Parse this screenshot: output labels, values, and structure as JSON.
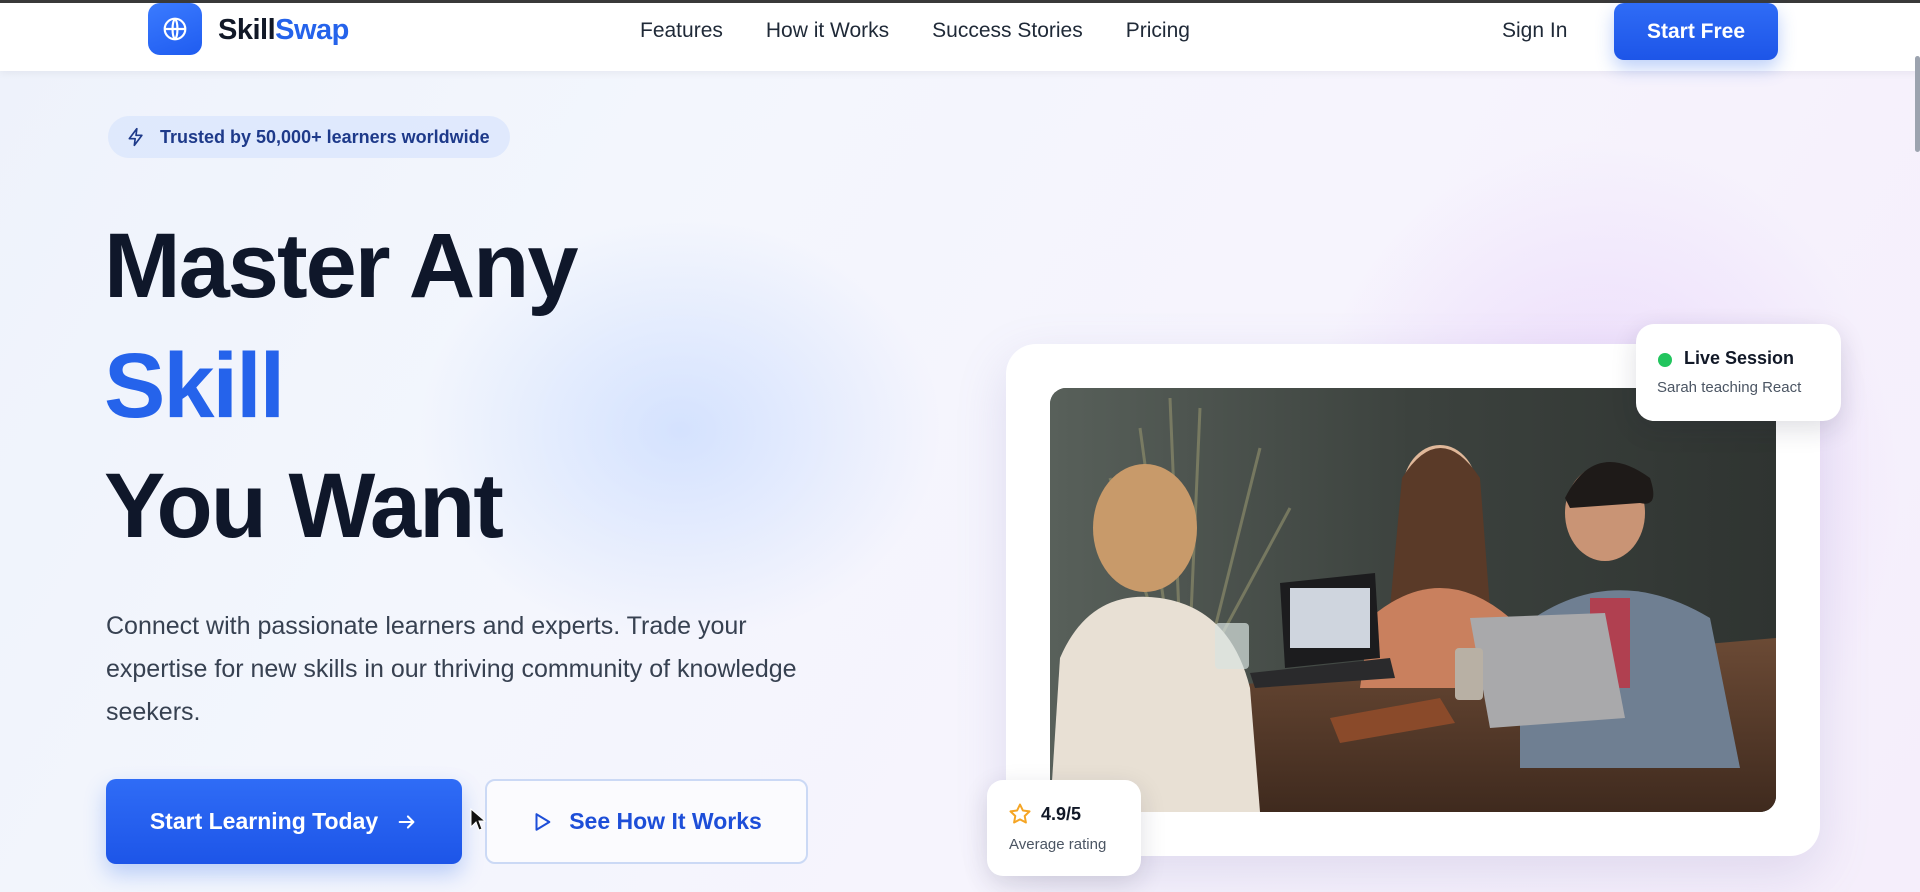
{
  "brand": {
    "name_part1": "Skill",
    "name_part2": "Swap"
  },
  "nav": {
    "links": [
      "Features",
      "How it Works",
      "Success Stories",
      "Pricing"
    ],
    "sign_in": "Sign In",
    "start_free": "Start Free"
  },
  "badge": {
    "text": "Trusted by 50,000+ learners worldwide",
    "icon": "lightning-icon"
  },
  "hero": {
    "line1": "Master Any",
    "line2": "Skill",
    "line3": "You Want",
    "description": "Connect with passionate learners and experts. Trade your expertise for new skills in our thriving community of knowledge seekers."
  },
  "cta": {
    "primary_label": "Start Learning Today",
    "secondary_label": "See How It Works"
  },
  "live_card": {
    "title": "Live Session",
    "subtitle": "Sarah teaching React",
    "status_color": "#22c55e"
  },
  "rating_card": {
    "value": "4.9/5",
    "subtitle": "Average rating"
  },
  "colors": {
    "accent": "#2563eb",
    "heading": "#0f172a"
  }
}
